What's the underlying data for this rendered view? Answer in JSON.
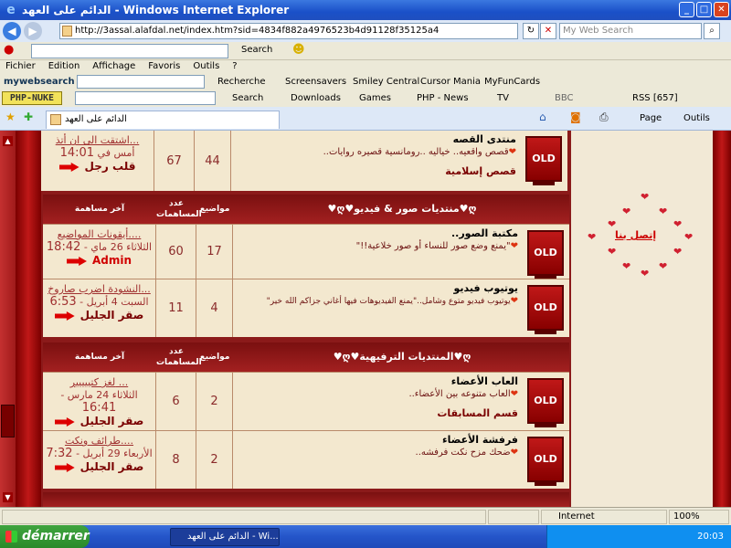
{
  "window": {
    "title": "ﺍﻟﺪﺍﺋﻢ ﻋﻠﻰ ﺍﻟﻌﻬﺪ - Windows Internet Explorer",
    "min": "_",
    "max": "□",
    "close": "✕"
  },
  "address": {
    "url": "http://3assal.alafdal.net/index.htm?sid=4834f882a4976523b4d91128f35125a4",
    "search_placeholder": "My Web Search"
  },
  "toolbar1": {
    "search_label": "Search"
  },
  "menu": [
    "Fichier",
    "Edition",
    "Affichage",
    "Favoris",
    "Outils",
    "?"
  ],
  "toolbar2": {
    "brand": "mywebsearch",
    "recherche": "Recherche",
    "screensavers": "Screensavers",
    "smiley": "Smiley Central",
    "cursor": "Cursor Mania",
    "funcards": "MyFunCards"
  },
  "toolbar3": {
    "logo": "PHP-NUKE",
    "search": "Search",
    "downloads": "Downloads",
    "games": "Games",
    "phpnews": "PHP - News",
    "tv": "TV",
    "bbc": "BBC",
    "rss": "RSS [657]"
  },
  "tab": {
    "title": "ﺍﻟﺪﺍﺋﻢ ﻋﻠﻰ ﺍﻟﻌﻬﺪ",
    "page": "Page",
    "outils": "Outils"
  },
  "forum": {
    "top_row": {
      "name": "منتدى القصه",
      "desc": "قصص واقعيه.. خياليه ..رومانسية قصيره روايات..",
      "sub": "قصص إسلامية",
      "topics": "44",
      "posts": "67",
      "last_title": "اشتقت الى ان أتذ...",
      "last_date": "أمس في",
      "last_time": "14:01",
      "last_user": "قلب رجل"
    },
    "sections": [
      {
        "title": "♥ღ♥منتديات صور & فيديو♥ღ",
        "col_last": "آخر مساهمة",
        "col_posts": "عدد المساهمات",
        "col_topics": "مواضيع",
        "rows": [
          {
            "name": "مكتبة الصور..",
            "desc": "\"يمنع وضع صور للنساء أو صور خلاعية!!\"",
            "topics": "17",
            "posts": "60",
            "last_title": "أيقونات المواضيع....",
            "last_date": "الثلاثاء 26 ماي -",
            "last_time": "18:42",
            "last_user": "Admin",
            "admin": true
          },
          {
            "name": "يوتيوب فيديو",
            "desc": "يوتيوب فيديو متوع وشامل..\"يمنع الفيديوهات فيها أغاني جزاكم الله خير\"",
            "topics": "4",
            "posts": "11",
            "last_title": "النشودة اضرب صاروخ...",
            "last_date": "السبت 4 أبريل -",
            "last_time": "6:53",
            "last_user": "صقر الجليل",
            "admin": false
          }
        ]
      },
      {
        "title": "♥ღ♥المنتديات الترفيهية♥ღ",
        "col_last": "آخر مساهمة",
        "col_posts": "عدد المساهمات",
        "col_topics": "مواضيع",
        "rows": [
          {
            "name": "العاب الأعضاء",
            "desc": "العاب متنوعه بين الأعضاء..",
            "sub": "قسم المسابقات",
            "topics": "2",
            "posts": "6",
            "last_title": "لغز كتييييير ...",
            "last_date": "الثلاثاء 24 مارس -",
            "last_time": "16:41",
            "last_user": "صقر الجليل",
            "admin": false
          },
          {
            "name": "فرفشة الأعضاء",
            "desc": "ضحك مزح نكت فرفشه..",
            "topics": "2",
            "posts": "8",
            "last_title": "طرائف ونكت....",
            "last_date": "الأربعاء 29 أبريل -",
            "last_time": "7:32",
            "last_user": "صقر الجليل",
            "admin": false
          }
        ]
      }
    ],
    "old_label": "OLD",
    "contact": "إتصل بنا"
  },
  "status": {
    "zone": "Internet",
    "zoom": "100%"
  },
  "taskbar": {
    "start": "démarrer",
    "task": "ﺍﻟﺪﺍﺋﻢ ﻋﻠﻰ ﺍﻟﻌﻬﺪ - Wi...",
    "clock": "20:03"
  }
}
